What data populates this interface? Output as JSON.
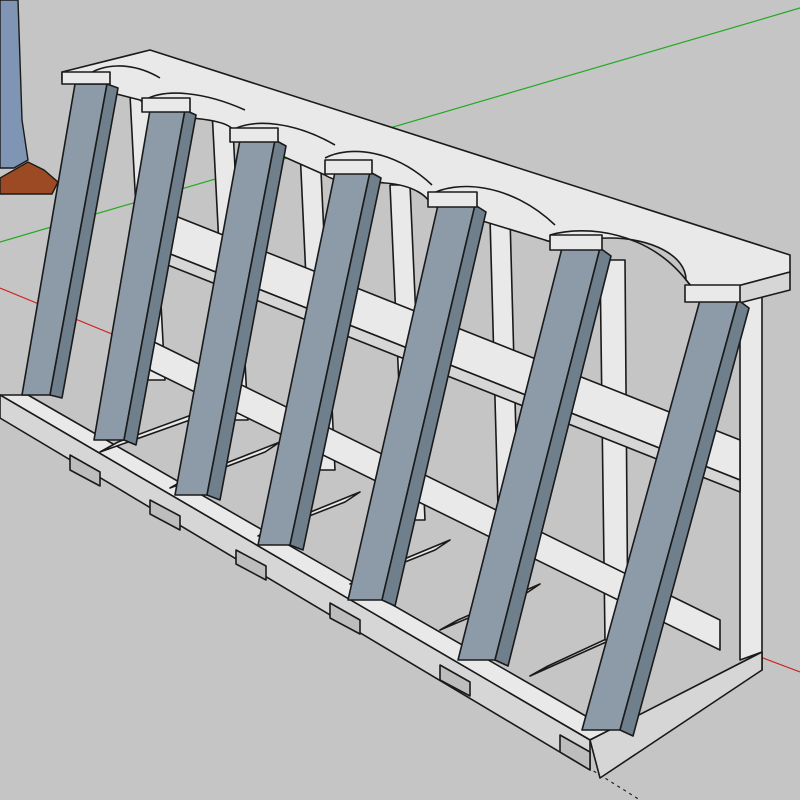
{
  "viewport": {
    "colors": {
      "background": "#c5c5c5",
      "axis_green": "#22aa22",
      "axis_red": "#cc2222",
      "axis_dashed": "#222222",
      "post": "#8c9ba7",
      "wood": "#e9e9e9"
    }
  },
  "model": {
    "posts": 7,
    "cradles": 6
  }
}
